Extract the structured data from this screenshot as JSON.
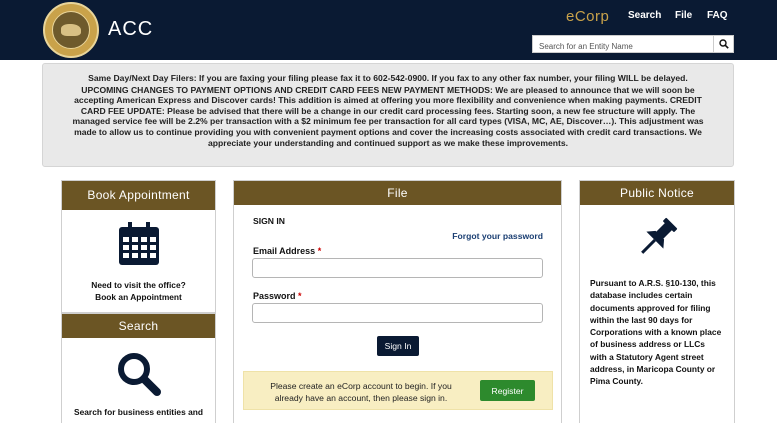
{
  "header": {
    "brand": "ACC",
    "ecorp": "eCorp",
    "nav": {
      "search": "Search",
      "file": "File",
      "faq": "FAQ"
    },
    "search_placeholder": "Search for an Entity Name"
  },
  "announcement": {
    "line1": "Same Day/Next Day Filers: If you are faxing your filing please fax it to 602-542-0900. If you fax to any other fax number, your filing WILL be delayed.",
    "line2": "UPCOMING CHANGES TO PAYMENT OPTIONS AND CREDIT CARD FEES NEW PAYMENT METHODS: We are pleased to announce that we will soon be accepting American Express and Discover cards! This addition is aimed at offering you more flexibility and convenience when making payments. CREDIT CARD FEE UPDATE: Please be advised that there will be a change in our credit card processing fees. Starting soon, a new fee structure will apply. The managed service fee will be 2.2% per transaction with a $2 minimum fee per transaction for all card types (VISA, MC, AE, Discover…). This adjustment was made to allow us to continue providing you with convenient payment options and cover the increasing costs associated with credit card transactions. We appreciate your understanding and continued support as we make these improvements."
  },
  "book": {
    "title": "Book Appointment",
    "line1": "Need to visit the office?",
    "line2": "Book an Appointment"
  },
  "search_panel": {
    "title": "Search",
    "text": "Search for business entities and"
  },
  "file": {
    "title": "File",
    "signin_title": "SIGN IN",
    "forgot": "Forgot your password",
    "email_label": "Email Address",
    "password_label": "Password",
    "required": "*",
    "signin_button": "Sign In",
    "register_text": "Please create an eCorp account to begin. If you already have an account, then please sign in.",
    "register_button": "Register"
  },
  "notice": {
    "title": "Public Notice",
    "text": "Pursuant to A.R.S. §10-130, this database includes certain documents approved for filing within the last 90 days for Corporations with a known place of business address or LLCs with a Statutory Agent street address, in Maricopa County or Pima County."
  },
  "colors": {
    "header_bg": "#0a1a33",
    "panel_head": "#6b5524",
    "ecorp_gold": "#c9a24a",
    "register_green": "#2d8a2d"
  },
  "icons": {
    "calendar": "calendar-icon",
    "search": "magnifier-icon",
    "pin": "pushpin-icon"
  }
}
